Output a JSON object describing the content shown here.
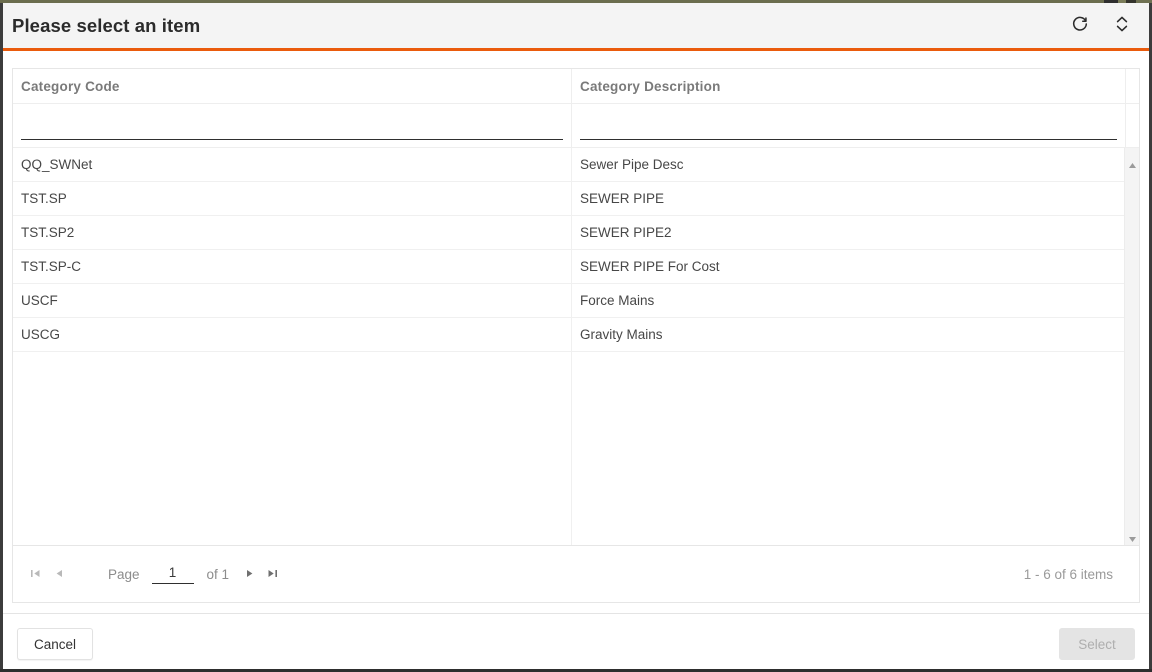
{
  "window": {
    "accent_color": "#ea5b0c",
    "titlebar_color": "#f4f4f4"
  },
  "header": {
    "title": "Please select an item",
    "refresh_icon": "refresh-icon",
    "collapse_icon": "chevron-up-down-icon"
  },
  "grid": {
    "columns": [
      {
        "key": "code",
        "label": "Category Code",
        "filter_value": "",
        "filter_placeholder": ""
      },
      {
        "key": "description",
        "label": "Category Description",
        "filter_value": "",
        "filter_placeholder": ""
      }
    ],
    "rows": [
      {
        "code": "QQ_SWNet",
        "description": "Sewer Pipe Desc"
      },
      {
        "code": "TST.SP",
        "description": "SEWER PIPE"
      },
      {
        "code": "TST.SP2",
        "description": "SEWER PIPE2"
      },
      {
        "code": "TST.SP-C",
        "description": "SEWER PIPE For Cost"
      },
      {
        "code": "USCF",
        "description": "Force Mains"
      },
      {
        "code": "USCG",
        "description": "Gravity Mains"
      }
    ],
    "scrollbar": {
      "up_icon": "scroll-up-arrow-icon",
      "down_icon": "scroll-down-arrow-icon"
    }
  },
  "pager": {
    "first_icon": "go-to-first-page-icon",
    "prev_icon": "go-to-previous-page-icon",
    "next_icon": "go-to-next-page-icon",
    "last_icon": "go-to-last-page-icon",
    "page_label": "Page",
    "page_value": "1",
    "of_label": "of 1",
    "summary": "1 - 6 of 6 items"
  },
  "footer": {
    "cancel_label": "Cancel",
    "select_label": "Select",
    "select_disabled": true
  }
}
